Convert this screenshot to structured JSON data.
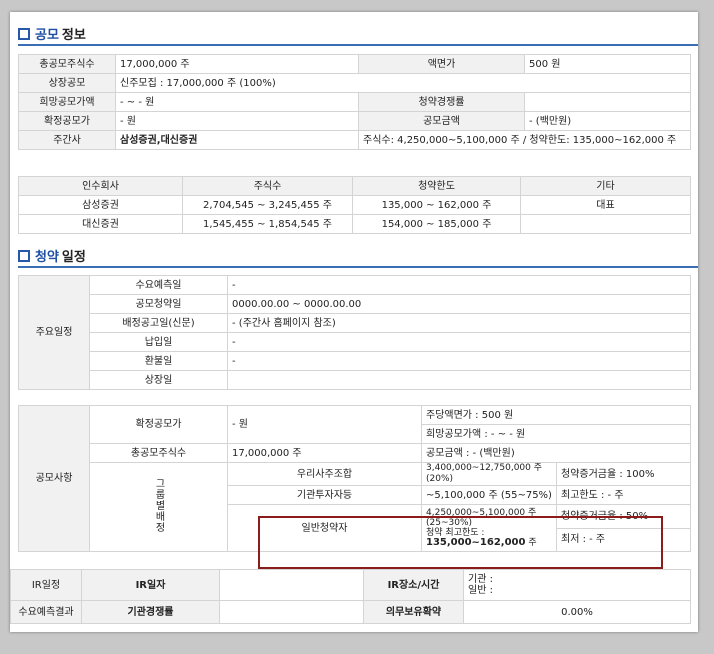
{
  "offering": {
    "title_hl": "공모",
    "title": "정보",
    "rows": [
      [
        "총공모주식수",
        "17,000,000 주",
        "액면가",
        "500 원"
      ],
      [
        "상장공모",
        "신주모집 : 17,000,000 주 (100%)"
      ],
      [
        "희망공모가액",
        "- ~ - 원",
        "청약경쟁률",
        ""
      ],
      [
        "확정공모가",
        "- 원",
        "공모금액",
        "- (백만원)"
      ]
    ],
    "underwriter_label": "주간사",
    "underwriter_value": "삼성증권,대신증권",
    "underwriter_detail": "주식수: 4,250,000~5,100,000 주  /  청약한도: 135,000~162,000 주"
  },
  "underwriters": {
    "headers": [
      "인수회사",
      "주식수",
      "청약한도",
      "기타"
    ],
    "rows": [
      [
        "삼성증권",
        "2,704,545 ~ 3,245,455 주",
        "135,000 ~ 162,000 주",
        "대표"
      ],
      [
        "대신증권",
        "1,545,455 ~ 1,854,545 주",
        "154,000 ~ 185,000 주",
        ""
      ]
    ]
  },
  "schedule": {
    "title_hl": "청약",
    "title": "일정",
    "main_label": "주요일정",
    "main_rows": [
      [
        "수요예측일",
        "-"
      ],
      [
        "공모청약일",
        "0000.00.00  ~  0000.00.00"
      ],
      [
        "배정공고일(신문)",
        "- (주간사 홈페이지 참조)"
      ],
      [
        "납입일",
        "-"
      ],
      [
        "환불일",
        "-"
      ],
      [
        "상장일",
        ""
      ]
    ],
    "notice_label": "공모사항",
    "confirmed_price_label": "확정공모가",
    "confirmed_price_value": "- 원",
    "par_value_text": "주당액면가 :  500 원",
    "hope_price_text": "희망공모가액 :  - ~ - 원",
    "total_shares_label": "총공모주식수",
    "total_shares_value": "17,000,000 주",
    "offer_amount_text": "공모금액 : - (백만원)",
    "group_alloc_label": "그룹별배정",
    "employee_label": "우리사주조합",
    "employee_shares": "3,400,000~12,750,000 주 (20%)",
    "employee_deposit": "청약증거금율 : 100%",
    "inst_label": "기관투자자등",
    "inst_shares": "~5,100,000 주  (55~75%)",
    "inst_limit": "최고한도 :  - 주",
    "retail_label": "일반청약자",
    "retail_shares": "4,250,000~5,100,000 주 (25~30%)",
    "retail_deposit": "청약증거금율 : 50%",
    "retail_max_label": "청약 최고한도 :",
    "retail_max_value": "135,000~162,000",
    "retail_max_unit": "주",
    "retail_min": "최저 :  - 주",
    "ir_label": "IR일정",
    "ir_date_label": "IR일자",
    "ir_place_label": "IR장소/시간",
    "ir_inst": "기관 :",
    "ir_general": "일반 :",
    "demand_label": "수요예측결과",
    "inst_comp_label": "기관경쟁률",
    "lockup_label": "의무보유확약",
    "lockup_value": "0.00%"
  }
}
